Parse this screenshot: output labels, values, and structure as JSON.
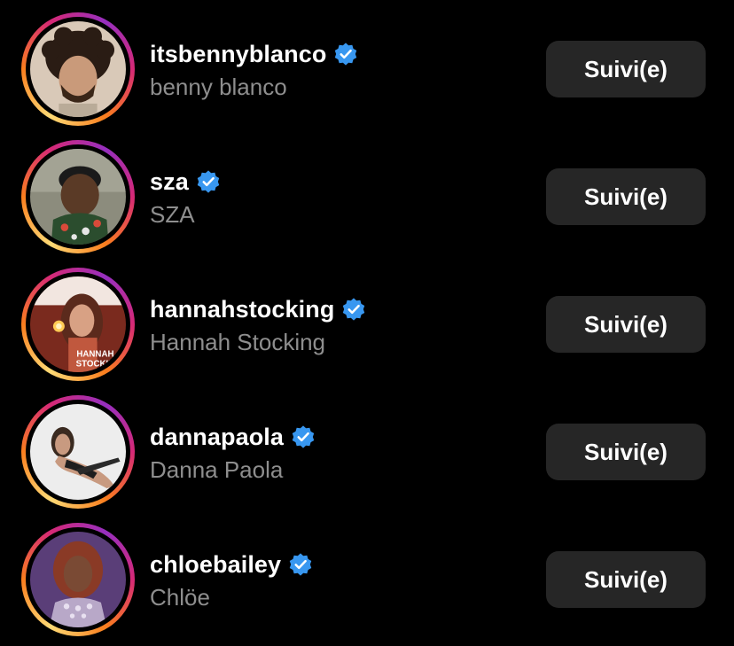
{
  "accounts": [
    {
      "username": "itsbennyblanco",
      "full_name": "benny blanco",
      "verified": true,
      "button_label": "Suivi(e)",
      "avatar_icon": "profile-photo"
    },
    {
      "username": "sza",
      "full_name": "SZA",
      "verified": true,
      "button_label": "Suivi(e)",
      "avatar_icon": "profile-photo"
    },
    {
      "username": "hannahstocking",
      "full_name": "Hannah Stocking",
      "verified": true,
      "button_label": "Suivi(e)",
      "avatar_icon": "profile-photo",
      "avatar_text": "HANNAH STOCKING"
    },
    {
      "username": "dannapaola",
      "full_name": "Danna Paola",
      "verified": true,
      "button_label": "Suivi(e)",
      "avatar_icon": "profile-photo"
    },
    {
      "username": "chloebailey",
      "full_name": "Chlöe",
      "verified": true,
      "button_label": "Suivi(e)",
      "avatar_icon": "profile-photo"
    }
  ],
  "colors": {
    "background": "#000000",
    "button_bg": "#262626",
    "secondary_text": "#8e8e8e",
    "verified_blue": "#3897f0"
  }
}
